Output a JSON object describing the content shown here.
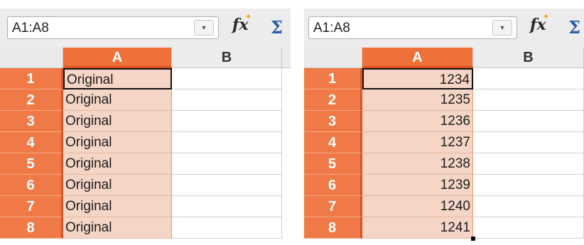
{
  "left_sheet": {
    "name_box": "A1:A8",
    "columns": [
      "A",
      "B"
    ],
    "rows": [
      {
        "num": "1",
        "a": "Original"
      },
      {
        "num": "2",
        "a": "Original"
      },
      {
        "num": "3",
        "a": "Original"
      },
      {
        "num": "4",
        "a": "Original"
      },
      {
        "num": "5",
        "a": "Original"
      },
      {
        "num": "6",
        "a": "Original"
      },
      {
        "num": "7",
        "a": "Original"
      },
      {
        "num": "8",
        "a": "Original"
      }
    ]
  },
  "right_sheet": {
    "name_box": "A1:A8",
    "columns": [
      "A",
      "B"
    ],
    "rows": [
      {
        "num": "1",
        "a": "1234"
      },
      {
        "num": "2",
        "a": "1235"
      },
      {
        "num": "3",
        "a": "1236"
      },
      {
        "num": "4",
        "a": "1237"
      },
      {
        "num": "5",
        "a": "1238"
      },
      {
        "num": "6",
        "a": "1239"
      },
      {
        "num": "7",
        "a": "1240"
      },
      {
        "num": "8",
        "a": "1241"
      }
    ]
  },
  "icons": {
    "dropdown": "chevron-down-icon",
    "function_wizard": "function-wizard-icon",
    "sum": "sum-icon",
    "function_glyph": "fx",
    "sum_glyph": "Σ"
  },
  "colors": {
    "selection_header": "#f0703a",
    "selection_cell": "#f5d5c6",
    "toolbar": "#ececec"
  }
}
